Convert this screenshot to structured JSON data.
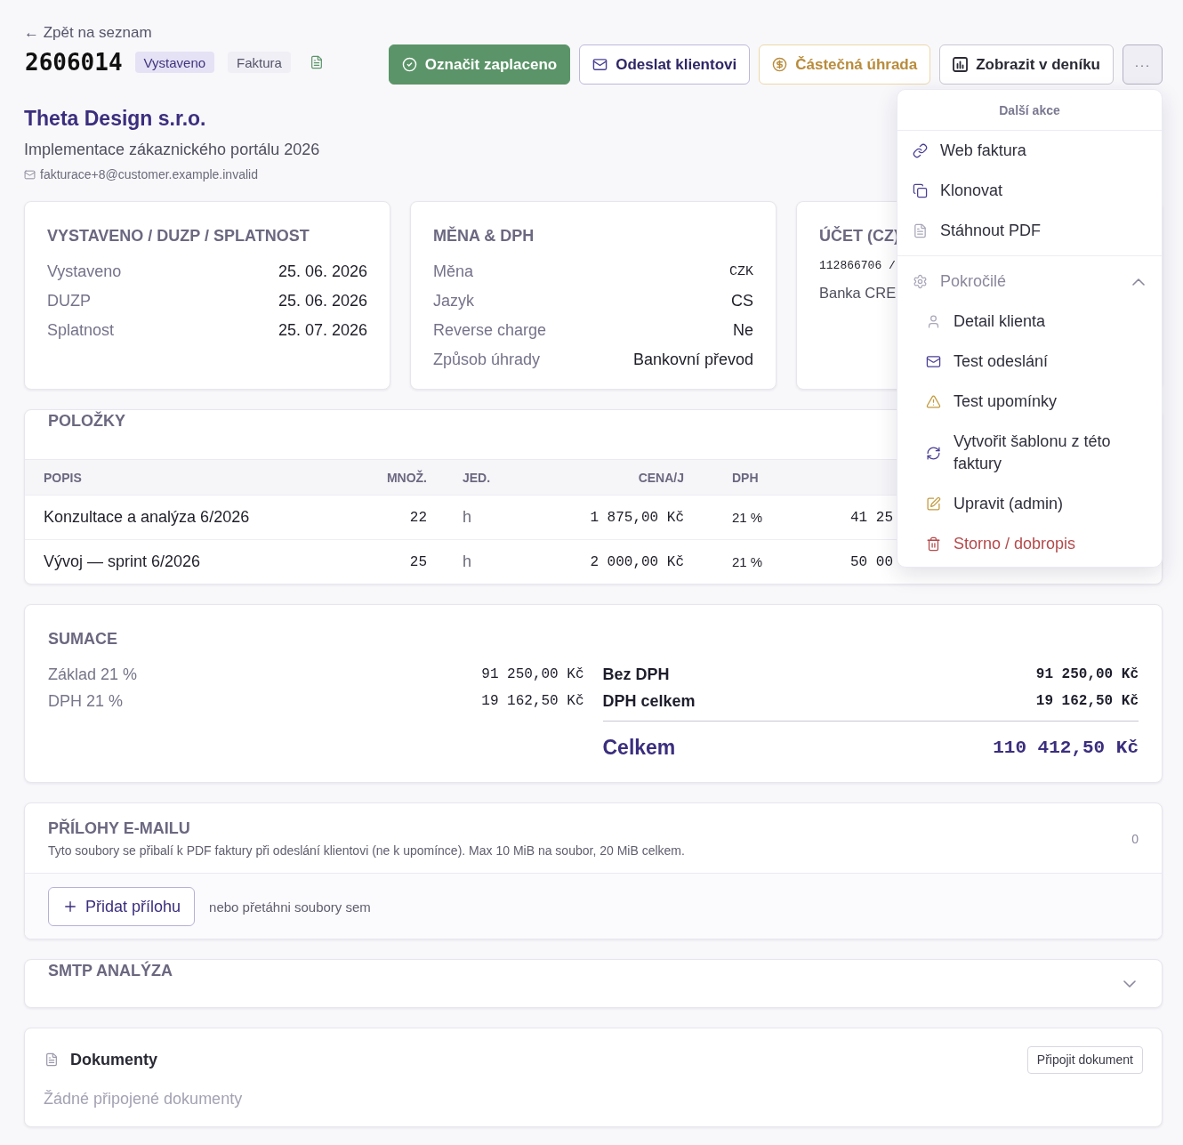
{
  "back_link": "← Zpět na seznam",
  "invoice": {
    "number": "2606014",
    "badges": [
      {
        "label": "Vystaveno",
        "kind": "status"
      },
      {
        "label": "Faktura",
        "kind": "type"
      }
    ]
  },
  "actions": [
    {
      "label": "Označit zaplaceno",
      "kind": "primary"
    },
    {
      "label": "Odeslat klientovi",
      "kind": "outline"
    },
    {
      "label": "Částečná úhrada",
      "kind": "warning"
    },
    {
      "label": "Zobrazit v deníku",
      "kind": "default"
    }
  ],
  "more_menu": {
    "button": "···",
    "open": true,
    "title": "Další akce",
    "items": [
      {
        "label": "Web faktura",
        "danger": false
      },
      {
        "label": "Klonovat",
        "danger": false
      },
      {
        "label": "Stáhnout PDF",
        "danger": false
      }
    ],
    "advanced": {
      "label": "Pokročilé",
      "expanded": true,
      "items": [
        {
          "label": "Detail klienta",
          "danger": false
        },
        {
          "label": "Test odeslání",
          "danger": false
        },
        {
          "label": "Test upomínky",
          "danger": false
        },
        {
          "label": "Vytvořit šablonu z této faktury",
          "danger": false
        },
        {
          "label": "Upravit (admin)",
          "danger": false
        },
        {
          "label": "Storno / dobropis",
          "danger": true
        }
      ]
    }
  },
  "client": {
    "name": "Theta Design s.r.o.",
    "project": "Implementace zákaznického portálu 2026",
    "email": "fakturace+8@customer.example.invalid"
  },
  "info_cards": [
    {
      "title": "VYSTAVENO / DUZP / SPLATNOST",
      "rows": [
        {
          "label": "Vystaveno",
          "value": "25. 06. 2026",
          "kind": "text"
        },
        {
          "label": "DUZP",
          "value": "25. 06. 2026",
          "kind": "text"
        },
        {
          "label": "Splatnost",
          "value": "25. 07. 2026",
          "kind": "text"
        }
      ]
    },
    {
      "title": "MĚNA & DPH",
      "rows": [
        {
          "label": "Měna",
          "value": "CZK",
          "kind": "code"
        },
        {
          "label": "Jazyk",
          "value": "CS",
          "kind": "text"
        },
        {
          "label": "Reverse charge",
          "value": "Ne",
          "kind": "text"
        },
        {
          "label": "Způsob úhrady",
          "value": "Bankovní převod",
          "kind": "text"
        }
      ]
    },
    {
      "title": "ÚČET (CZ)",
      "lines": [
        {
          "text": "112866706 /",
          "kind": "code"
        },
        {
          "text": "Banka CRE",
          "kind": "text"
        }
      ]
    }
  ],
  "items": {
    "title": "POLOŽKY",
    "columns": {
      "description": "POPIS",
      "quantity": "MNOŽ.",
      "unit": "JED.",
      "unit_price": "CENA/J",
      "vat": "DPH"
    },
    "rows": [
      {
        "description": "Konzultace a analýza 6/2026",
        "quantity": "22",
        "unit": "h",
        "unit_price": "1 875,00 Kč",
        "vat": "21 %",
        "column_6": "41 25"
      },
      {
        "description": "Vývoj — sprint 6/2026",
        "quantity": "25",
        "unit": "h",
        "unit_price": "2 000,00 Kč",
        "vat": "21 %",
        "column_6": "50 00"
      }
    ]
  },
  "summary": {
    "title": "SUMACE",
    "vat_breakdown": [
      {
        "label": "Základ 21 %",
        "value": "91 250,00 Kč"
      },
      {
        "label": "DPH 21 %",
        "value": "19 162,50 Kč"
      }
    ],
    "totals": [
      {
        "label": "Bez DPH",
        "value": "91 250,00 Kč"
      },
      {
        "label": "DPH celkem",
        "value": "19 162,50 Kč"
      }
    ],
    "grand_total": {
      "label": "Celkem",
      "value": "110 412,50 Kč"
    }
  },
  "attachments": {
    "title": "PŘÍLOHY E-MAILU",
    "description": "Tyto soubory se přibalí k PDF faktury při odeslání klientovi (ne k upomínce). Max 10 MiB na soubor, 20 MiB celkem.",
    "count": "0",
    "add_button": "Přidat přílohu",
    "drop_hint": "nebo přetáhni soubory sem"
  },
  "smtp": {
    "title": "SMTP ANALÝZA",
    "expanded": false
  },
  "documents": {
    "title": "Dokumenty",
    "attach_button": "Připojit dokument",
    "empty_text": "Žádné připojené dokumenty"
  }
}
